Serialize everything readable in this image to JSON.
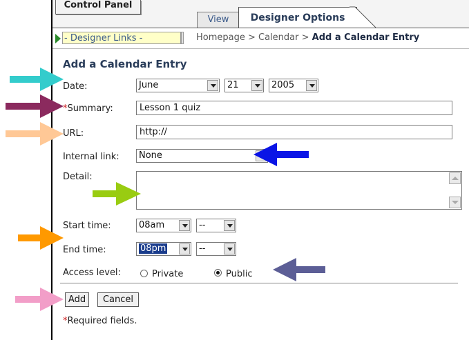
{
  "top": {
    "control_panel": "Control Panel",
    "tabs": [
      {
        "label": "View"
      },
      {
        "label": "Designer Options"
      }
    ]
  },
  "nav": {
    "designer_links": "- Designer Links -",
    "breadcrumb": {
      "home": "Homepage",
      "sep1": " > ",
      "calendar": "Calendar",
      "sep2": " > ",
      "current": "Add a Calendar Entry"
    }
  },
  "form": {
    "title": "Add a Calendar Entry",
    "date": {
      "label": "Date:",
      "month": "June",
      "day": "21",
      "year": "2005"
    },
    "summary": {
      "required_mark": "*",
      "label": "Summary:",
      "value": "Lesson 1 quiz"
    },
    "url": {
      "label": "URL:",
      "value": "http://"
    },
    "internal_link": {
      "label": "Internal link:",
      "value": "None"
    },
    "detail": {
      "label": "Detail:",
      "value": ""
    },
    "start_time": {
      "label": "Start time:",
      "hour": "08am",
      "minute": "--"
    },
    "end_time": {
      "label": "End time:",
      "hour": "08pm",
      "minute": "--"
    },
    "access_level": {
      "label": "Access level:",
      "options": [
        {
          "label": "Private",
          "selected": false
        },
        {
          "label": "Public",
          "selected": true
        }
      ]
    },
    "buttons": {
      "add": "Add",
      "cancel": "Cancel"
    },
    "required_note": {
      "mark": "*",
      "text": "Required fields."
    }
  },
  "annotation_arrows": [
    {
      "name": "date-arrow",
      "color": "#33cccc"
    },
    {
      "name": "summary-arrow",
      "color": "#8b2a5e"
    },
    {
      "name": "url-arrow",
      "color": "#ffc896"
    },
    {
      "name": "internal-link-arrow",
      "color": "#0a14e6"
    },
    {
      "name": "detail-arrow",
      "color": "#99cc11"
    },
    {
      "name": "time-arrow",
      "color": "#ff9900"
    },
    {
      "name": "access-level-arrow",
      "color": "#5c5e96"
    },
    {
      "name": "add-button-arrow",
      "color": "#f29ec8"
    }
  ]
}
